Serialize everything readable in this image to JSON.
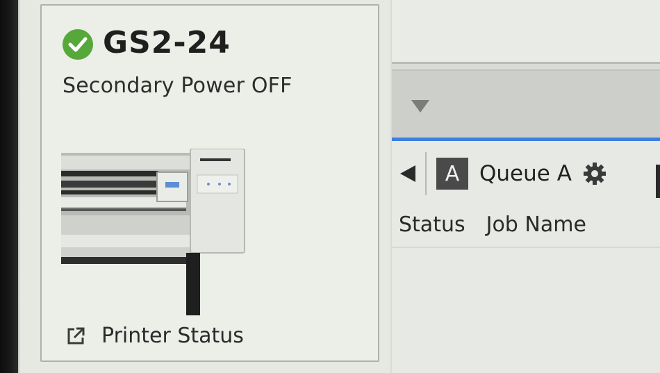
{
  "device": {
    "name": "GS2-24",
    "status_text": "Secondary Power OFF",
    "status_color": "#55a839",
    "printer_status_link": "Printer Status"
  },
  "queue": {
    "badge": "A",
    "label": "Queue A"
  },
  "table": {
    "columns": [
      "Status",
      "Job Name"
    ]
  },
  "colors": {
    "accent_line": "#3e7fe0"
  },
  "icons": {
    "status": "check-circle-icon",
    "link": "external-link-icon",
    "dropdown": "caret-down-icon",
    "tab_prev": "triangle-left-icon",
    "settings": "gear-icon"
  }
}
